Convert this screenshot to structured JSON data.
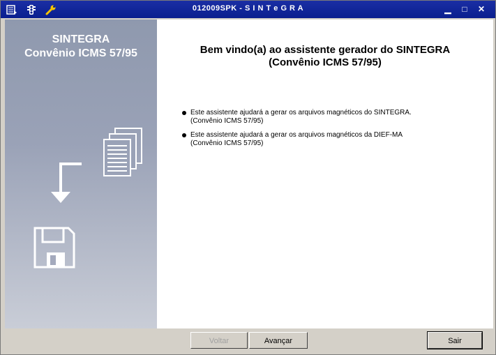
{
  "window": {
    "title": "012009SPK - S I N T e G R A",
    "controls": {
      "minimize": "▁",
      "maximize": "□",
      "close": "✕"
    }
  },
  "sidebar": {
    "title_line1": "SINTEGRA",
    "title_line2": "Convênio ICMS 57/95",
    "icons": [
      "documents-icon",
      "arrow-down-icon",
      "floppy-disk-icon"
    ]
  },
  "content": {
    "heading_line1": "Bem vindo(a) ao assistente gerador do SINTEGRA",
    "heading_line2": "(Convênio ICMS 57/95)",
    "bullets": [
      {
        "line1": "Este assistente ajudará a gerar os arquivos magnéticos do SINTEGRA.",
        "line2": "(Convênio ICMS 57/95)"
      },
      {
        "line1": "Este assistente ajudará a gerar os arquivos magnéticos da DIEF-MA",
        "line2": "(Convênio ICMS 57/95)"
      }
    ]
  },
  "buttons": {
    "back": "Voltar",
    "next": "Avançar",
    "exit": "Sair"
  }
}
